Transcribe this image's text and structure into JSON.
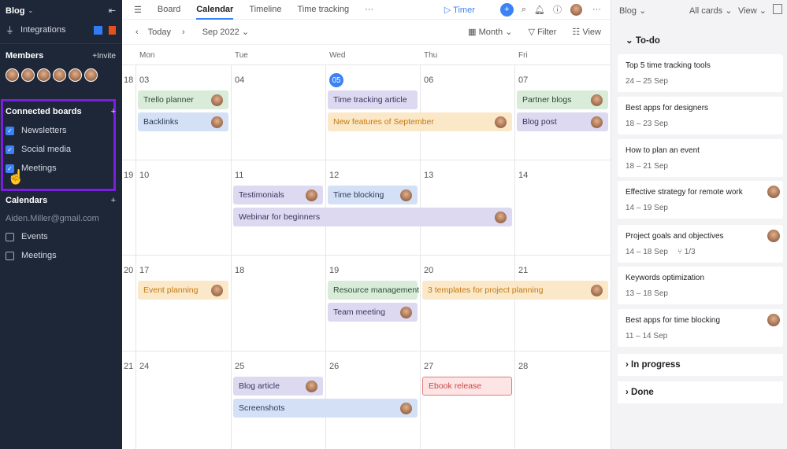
{
  "sidebar": {
    "workspace": "Blog",
    "integrations": "Integrations",
    "members_title": "Members",
    "invite": "+Invite",
    "connected_title": "Connected boards",
    "boards": [
      {
        "label": "Newsletters",
        "checked": true
      },
      {
        "label": "Social media",
        "checked": true
      },
      {
        "label": "Meetings",
        "checked": true
      }
    ],
    "calendars_title": "Calendars",
    "email": "Aiden.Miller@gmail.com",
    "calendars": [
      {
        "label": "Events",
        "checked": false
      },
      {
        "label": "Meetings",
        "checked": false
      }
    ]
  },
  "tabs": [
    "Board",
    "Calendar",
    "Timeline",
    "Time tracking"
  ],
  "active_tab": "Calendar",
  "more": "···",
  "timer": "Timer",
  "toolbar": {
    "today": "Today",
    "month": "Sep 2022",
    "view_mode": "Month",
    "filter": "Filter",
    "view": "View"
  },
  "days": [
    "Mon",
    "Tue",
    "Wed",
    "Thu",
    "Fri"
  ],
  "weeks": [
    {
      "num": "18",
      "dates": [
        "03",
        "04",
        "05",
        "06",
        "07"
      ]
    },
    {
      "num": "19",
      "dates": [
        "10",
        "11",
        "12",
        "13",
        "14"
      ]
    },
    {
      "num": "20",
      "dates": [
        "17",
        "18",
        "19",
        "20",
        "21"
      ]
    },
    {
      "num": "21",
      "dates": [
        "24",
        "25",
        "26",
        "27",
        "28"
      ]
    }
  ],
  "events": [
    {
      "title": "Trello planner",
      "color": "g",
      "week": 0,
      "col": 0,
      "span": 1,
      "slot": 0
    },
    {
      "title": "Backlinks",
      "color": "b",
      "week": 0,
      "col": 0,
      "span": 1,
      "slot": 1
    },
    {
      "title": "Time tracking article",
      "color": "p",
      "week": 0,
      "col": 2,
      "span": 1,
      "slot": 0,
      "noav": true
    },
    {
      "title": "New features of September",
      "color": "o",
      "week": 0,
      "col": 2,
      "span": 2,
      "slot": 1
    },
    {
      "title": "Partner blogs",
      "color": "g",
      "week": 0,
      "col": 4,
      "span": 1,
      "slot": 0
    },
    {
      "title": "Blog post",
      "color": "p",
      "week": 0,
      "col": 4,
      "span": 1,
      "slot": 1
    },
    {
      "title": "Testimonials",
      "color": "p",
      "week": 1,
      "col": 1,
      "span": 1,
      "slot": 0
    },
    {
      "title": "Time blocking",
      "color": "b",
      "week": 1,
      "col": 2,
      "span": 1,
      "slot": 0
    },
    {
      "title": "Webinar for beginners",
      "color": "p",
      "week": 1,
      "col": 1,
      "span": 3,
      "slot": 1
    },
    {
      "title": "Event planning",
      "color": "o",
      "week": 2,
      "col": 0,
      "span": 1,
      "slot": 0
    },
    {
      "title": "Resource management",
      "color": "g",
      "week": 2,
      "col": 2,
      "span": 1,
      "slot": 0,
      "noav": true
    },
    {
      "title": "3 templates for project planning",
      "color": "o",
      "week": 2,
      "col": 3,
      "span": 2,
      "slot": 0
    },
    {
      "title": "Team meeting",
      "color": "p",
      "week": 2,
      "col": 2,
      "span": 1,
      "slot": 1
    },
    {
      "title": "Blog article",
      "color": "p",
      "week": 3,
      "col": 1,
      "span": 1,
      "slot": 0
    },
    {
      "title": "Ebook release",
      "color": "r",
      "week": 3,
      "col": 3,
      "span": 1,
      "slot": 0,
      "noav": true
    },
    {
      "title": "Screenshots",
      "color": "b",
      "week": 3,
      "col": 1,
      "span": 2,
      "slot": 1
    }
  ],
  "right": {
    "board": "Blog",
    "all_cards": "All cards",
    "view": "View",
    "todo": "To-do",
    "in_progress": "In progress",
    "done": "Done",
    "cards": [
      {
        "title": "Top 5 time tracking tools",
        "dates": "24 – 25 Sep"
      },
      {
        "title": "Best apps for designers",
        "dates": "18 – 23 Sep"
      },
      {
        "title": "How to plan an event",
        "dates": "18 – 21 Sep"
      },
      {
        "title": "Effective strategy for remote work",
        "dates": "14 – 19 Sep",
        "av": true
      },
      {
        "title": "Project goals and objectives",
        "dates": "14 – 18 Sep",
        "sub": "1/3",
        "av": true
      },
      {
        "title": "Keywords optimization",
        "dates": "13 – 18 Sep"
      },
      {
        "title": "Best apps for time blocking",
        "dates": "11 – 14 Sep",
        "av": true
      }
    ]
  }
}
